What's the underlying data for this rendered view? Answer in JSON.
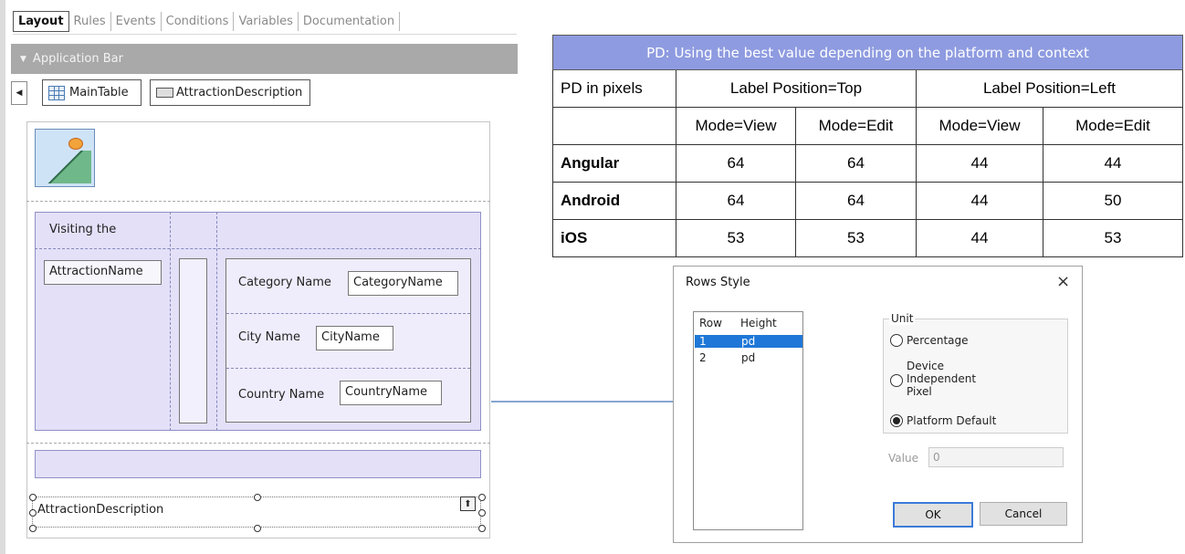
{
  "tabs": [
    "Layout",
    "Rules",
    "Events",
    "Conditions",
    "Variables",
    "Documentation"
  ],
  "active_tab": "Layout",
  "app_bar": {
    "label": "Application Bar"
  },
  "breadcrumb": {
    "main_table": "MainTable",
    "control": "AttractionDescription"
  },
  "form": {
    "visiting_label": "Visiting the",
    "attraction_name": "AttractionName",
    "category_label": "Category Name",
    "category_value": "CategoryName",
    "city_label": "City Name",
    "city_value": "CityName",
    "country_label": "Country Name",
    "country_value": "CountryName",
    "attraction_description": "AttractionDescription"
  },
  "pd_table": {
    "title": "PD: Using the best value depending on the platform and context",
    "header": [
      "PD in pixels",
      "Label Position=Top",
      "Label Position=Left"
    ],
    "subheader": [
      "",
      "Mode=View",
      "Mode=Edit",
      "Mode=View",
      "Mode=Edit"
    ],
    "rows": [
      {
        "name": "Angular",
        "values": [
          "64",
          "64",
          "44",
          "44"
        ]
      },
      {
        "name": "Android",
        "values": [
          "64",
          "64",
          "44",
          "50"
        ]
      },
      {
        "name": "iOS",
        "values": [
          "53",
          "53",
          "44",
          "53"
        ]
      }
    ]
  },
  "dialog": {
    "title": "Rows Style",
    "close": "×",
    "list_headers": [
      "Row",
      "Height"
    ],
    "rows": [
      {
        "row": "1",
        "height": "pd",
        "selected": true
      },
      {
        "row": "2",
        "height": "pd",
        "selected": false
      }
    ],
    "unit_label": "Unit",
    "options": [
      "Percentage",
      "Device\nIndependent\nPixel",
      "Platform Default"
    ],
    "selected_option": "Platform Default",
    "value_label": "Value",
    "value": "0",
    "ok": "OK",
    "cancel": "Cancel"
  }
}
